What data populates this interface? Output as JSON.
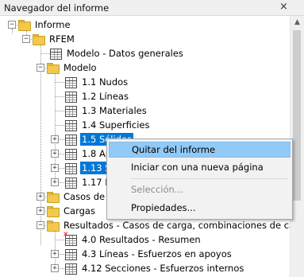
{
  "panel": {
    "title": "Navegador del informe",
    "close_glyph": "×"
  },
  "scrollbar": {
    "up_glyph": "▲",
    "down_glyph": "▼"
  },
  "tree": {
    "root": {
      "label": "Informe",
      "expander": "−"
    },
    "rfem": {
      "label": "RFEM",
      "expander": "−"
    },
    "modelo_datos": {
      "label": "Modelo - Datos generales"
    },
    "modelo": {
      "label": "Modelo",
      "expander": "−"
    },
    "items": [
      {
        "label": "1.1 Nudos"
      },
      {
        "label": "1.2 Líneas"
      },
      {
        "label": "1.3 Materiales"
      },
      {
        "label": "1.4 Superficies"
      },
      {
        "label": "1.5 Sólidos",
        "expander": "+"
      },
      {
        "label": "1.8 Ap",
        "expander": "+"
      },
      {
        "label": "1.13 S",
        "expander": "+"
      },
      {
        "label": "1.17 E",
        "expander": "+"
      }
    ],
    "casos_de": {
      "label": "Casos de",
      "expander": "+"
    },
    "cargas": {
      "label": "Cargas",
      "expander": "+"
    },
    "resultados": {
      "label": "Resultados - Casos de carga, combinaciones de ca",
      "expander": "−"
    },
    "res_items": [
      {
        "label": "4.0 Resultados - Resumen"
      },
      {
        "label": "4.3 Líneas - Esfuerzos en apoyos",
        "expander": "+"
      },
      {
        "label": "4.12 Secciones - Esfuerzos internos",
        "expander": "+"
      }
    ]
  },
  "context_menu": {
    "remove": "Quitar del informe",
    "new_page": "Iniciar con una nueva página",
    "selection": "Selección...",
    "properties": "Propiedades..."
  },
  "colors": {
    "selection": "#0078d7",
    "menu_hover": "#91c9f7",
    "folder": "#f2c94c"
  }
}
